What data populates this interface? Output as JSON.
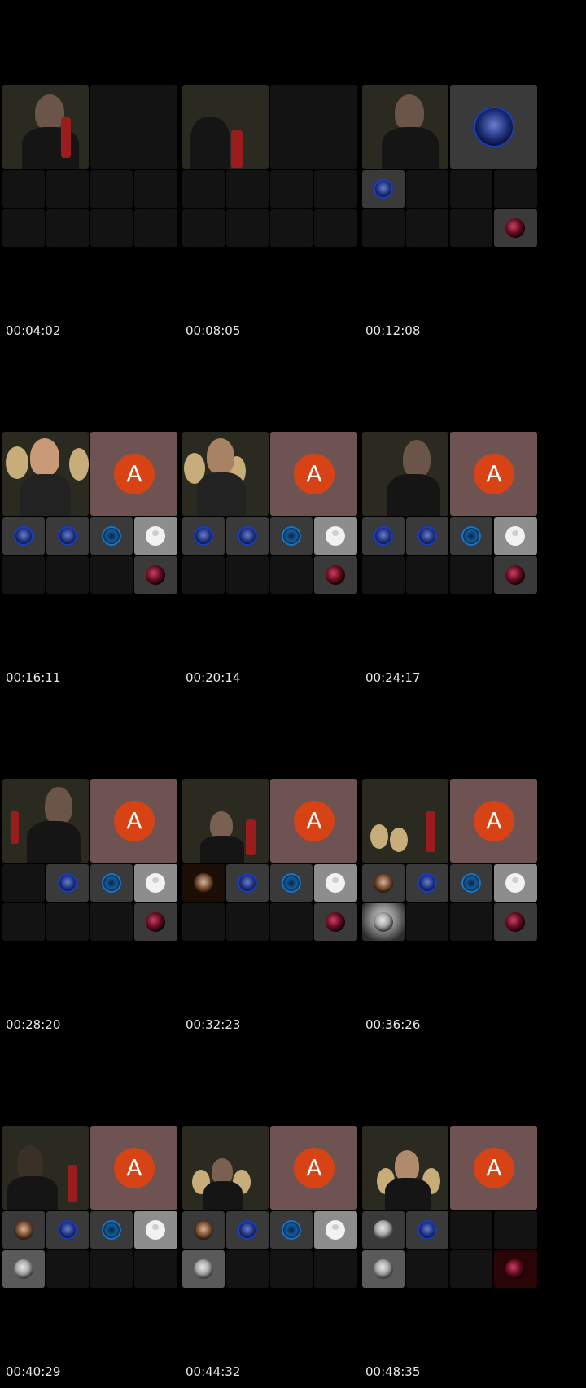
{
  "timestamps": [
    "00:04:02",
    "00:08:05",
    "00:12:08",
    "00:16:11",
    "00:20:14",
    "00:24:17",
    "00:28:20",
    "00:32:23",
    "00:36:26",
    "00:40:29",
    "00:44:32",
    "00:48:35"
  ],
  "avatar_letter": "A",
  "colors": {
    "background": "#000000",
    "tile": "#141414",
    "avatar_bg": "#6f5352",
    "avatar_letter_bg": "#d84315",
    "timestamp": "#e8e8e8"
  }
}
